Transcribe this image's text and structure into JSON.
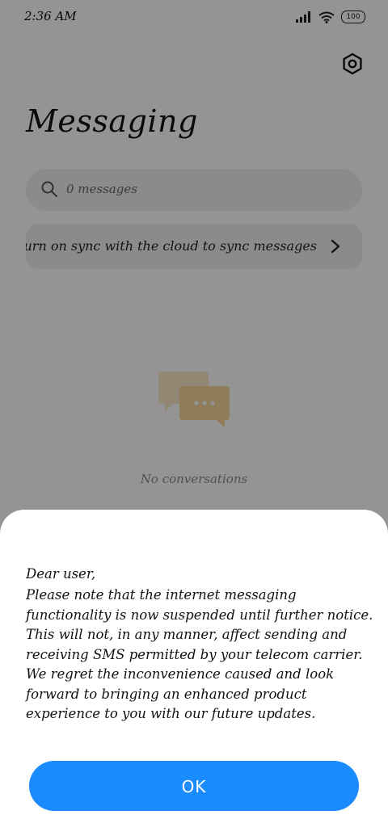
{
  "status_bar": {
    "time": "2:36 AM",
    "battery": "100"
  },
  "header": {
    "title": "Messaging"
  },
  "search": {
    "text": "0 messages"
  },
  "sync_banner": {
    "text": "Turn on sync with the cloud to sync messages"
  },
  "empty_state": {
    "text": "No conversations"
  },
  "dialog": {
    "greeting": "Dear user,",
    "body": "Please note that the internet messaging functionality is now suspended until further notice. This will not, in any manner, affect sending and receiving SMS permitted by your telecom carrier. We regret the inconvenience caused and look forward to bringing an enhanced product experience to you with our future updates.",
    "ok_label": "OK"
  },
  "colors": {
    "accent": "#1a8cff",
    "illustration": "#f7d89c"
  },
  "icons": [
    "signal-icon",
    "wifi-icon",
    "battery-icon",
    "settings-icon",
    "search-icon",
    "chevron-right-icon",
    "chat-bubbles-icon"
  ]
}
